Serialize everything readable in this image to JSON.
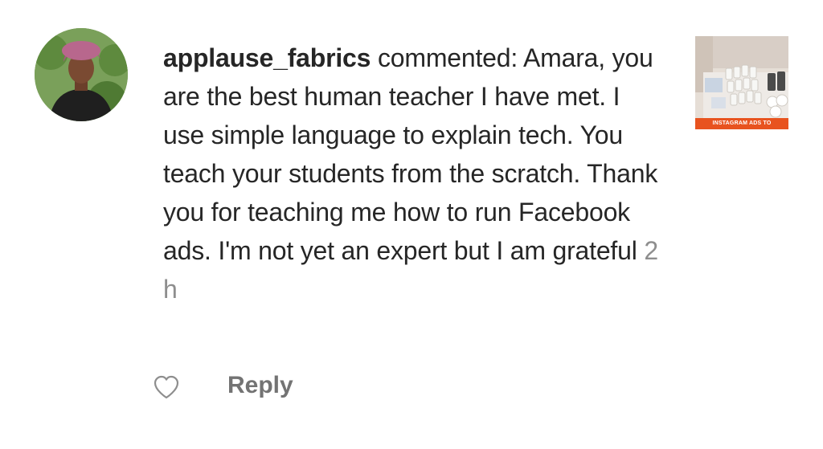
{
  "comment": {
    "username": "applause_fabrics",
    "action": "commented:",
    "text": "Amara, you are the best human teacher I have met. I use simple language to explain tech. You teach your students from the scratch. Thank you for teaching me how to run Facebook ads. I'm not yet an expert but I am grateful",
    "timestamp": "2 h"
  },
  "post_thumbnail": {
    "banner_text": "INSTAGRAM ADS TO"
  },
  "actions": {
    "reply_label": "Reply",
    "like_icon": "heart-outline-icon"
  },
  "colors": {
    "text": "#262626",
    "muted": "#8e8e8e",
    "reply": "#737373",
    "banner": "#e8531f"
  }
}
